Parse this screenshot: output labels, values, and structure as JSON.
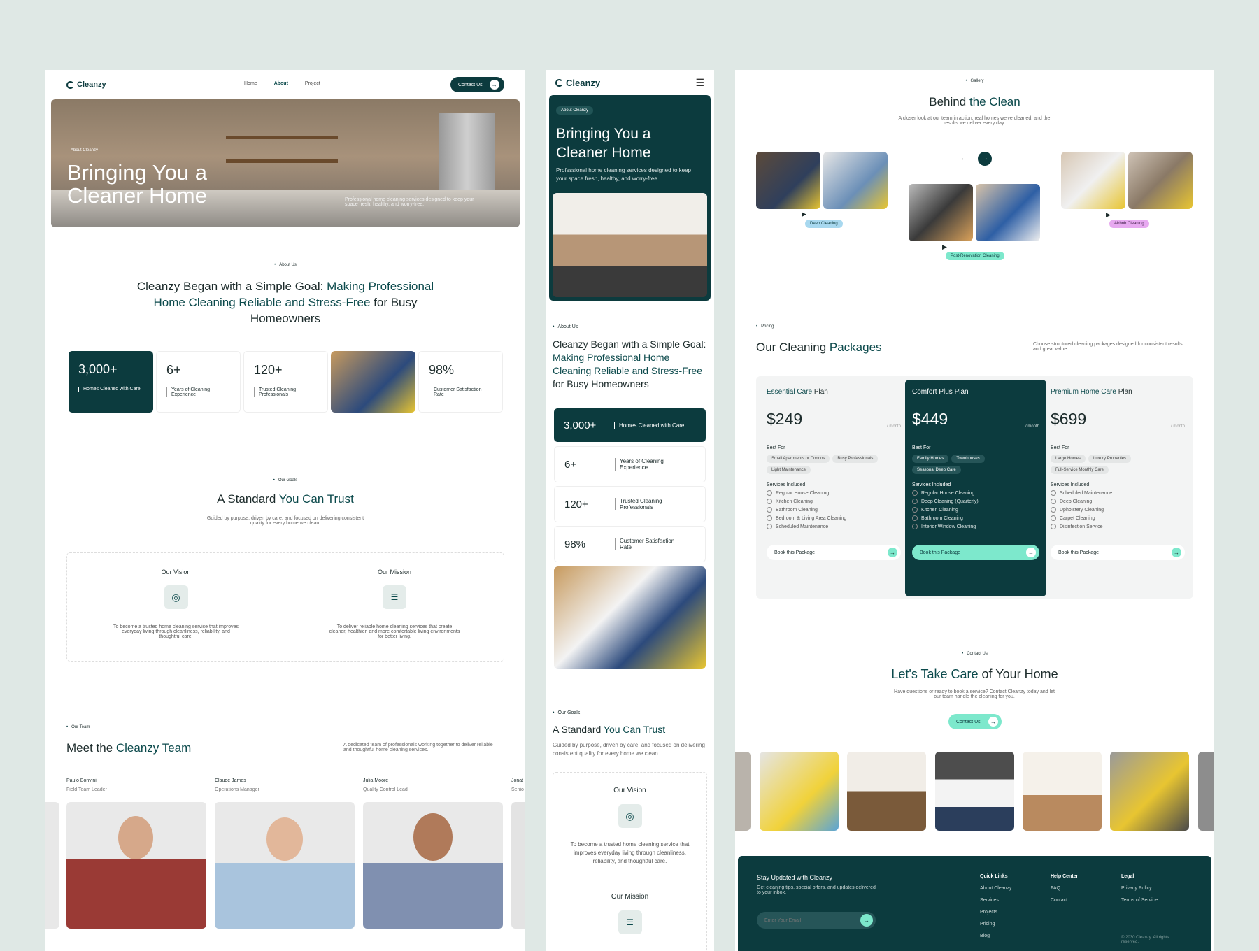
{
  "brand": "Cleanzy",
  "desktop": {
    "nav": {
      "home": "Home",
      "about": "About",
      "project": "Project",
      "contact": "Contact Us"
    },
    "hero": {
      "tag": "About Cleanzy",
      "title": "Bringing You a Cleaner Home",
      "desc": "Professional home cleaning services designed to keep your space fresh, healthy, and worry-free."
    },
    "about": {
      "tag": "About Us",
      "h_a": "Cleanzy Began with a Simple Goal: ",
      "h_b": "Making Professional Home Cleaning Reliable and Stress-Free",
      "h_c": " for Busy Homeowners"
    },
    "stats": [
      {
        "value": "3,000+",
        "label": "Homes Cleaned with Care"
      },
      {
        "value": "6+",
        "label": "Years of Cleaning Experience"
      },
      {
        "value": "120+",
        "label": "Trusted Cleaning Professionals"
      },
      {
        "value": "98%",
        "label": "Customer Satisfaction Rate"
      }
    ],
    "goals": {
      "tag": "Our Goals",
      "h_a": "A Standard ",
      "h_b": "You Can Trust",
      "desc": "Guided by purpose, driven by care, and focused on delivering consistent quality for every home we clean.",
      "vision_title": "Our Vision",
      "vision_text": "To become a trusted home cleaning service that improves everyday living through cleanliness, reliability, and thoughtful care.",
      "mission_title": "Our Mission",
      "mission_text": "To deliver reliable home cleaning services that create cleaner, healthier, and more comfortable living environments for better living."
    },
    "team": {
      "tag": "Our Team",
      "h_a": "Meet the ",
      "h_b": "Cleanzy Team",
      "desc": "A dedicated team of professionals working together to deliver reliable and thoughtful home cleaning services.",
      "members": [
        {
          "name": "Paulo Bonvini",
          "role": "Field Team Leader"
        },
        {
          "name": "Claude James",
          "role": "Operations Manager"
        },
        {
          "name": "Julia Moore",
          "role": "Quality Control Lead"
        },
        {
          "name": "Jonat",
          "role": "Senio"
        }
      ]
    }
  },
  "mobile": {
    "hero": {
      "tag": "About Cleanzy",
      "title": "Bringing You a Cleaner Home",
      "desc": "Professional home cleaning services designed to keep your space fresh, healthy, and worry-free."
    },
    "about": {
      "tag": "About Us",
      "h_a": "Cleanzy Began with a Simple Goal: ",
      "h_b": "Making Professional Home Cleaning Reliable and Stress-Free",
      "h_c": " for Busy Homeowners"
    },
    "stats": [
      {
        "value": "3,000+",
        "label": "Homes Cleaned with Care"
      },
      {
        "value": "6+",
        "label": "Years of Cleaning Experience"
      },
      {
        "value": "120+",
        "label": "Trusted Cleaning Professionals"
      },
      {
        "value": "98%",
        "label": "Customer Satisfaction Rate"
      }
    ],
    "goals": {
      "tag": "Our Goals",
      "h_a": "A Standard ",
      "h_b": "You Can Trust",
      "desc": "Guided by purpose, driven by care, and focused on delivering consistent quality for every home we clean.",
      "vision_title": "Our Vision",
      "vision_text": "To become a trusted home cleaning service that improves everyday living through cleanliness, reliability, and thoughtful care.",
      "mission_title": "Our Mission"
    }
  },
  "gallery": {
    "tag": "Gallery",
    "h_a": "Behind ",
    "h_b": "the Clean",
    "desc": "A closer look at our team in action, real homes we've cleaned, and the results we deliver every day.",
    "labels": [
      "Deep Cleaning",
      "Post-Renovation Cleaning",
      "Airbnb Cleaning"
    ]
  },
  "pricing": {
    "tag": "Pricing",
    "h_a": "Our Cleaning ",
    "h_b": "Packages",
    "desc": "Choose structured cleaning packages designed for consistent results and great value.",
    "per": "/ month",
    "best_for": "Best For",
    "included": "Services Included",
    "cta": "Book this Package",
    "plans": [
      {
        "name_a": "Essential Care ",
        "name_b": "Plan",
        "price": "$249",
        "tags": [
          "Small Apartments or Condos",
          "Busy Professionals",
          "Light Maintenance"
        ],
        "services": [
          "Regular House Cleaning",
          "Kitchen Cleaning",
          "Bathroom Cleaning",
          "Bedroom & Living Area Cleaning",
          "Scheduled Maintenance"
        ]
      },
      {
        "name_a": "Comfort Plus ",
        "name_b": "Plan",
        "price": "$449",
        "tags": [
          "Family Homes",
          "Townhouses",
          "Seasonal Deep Care"
        ],
        "services": [
          "Regular House Cleaning",
          "Deep Cleaning (Quarterly)",
          "Kitchen Cleaning",
          "Bathroom Cleaning",
          "Interior Window Cleaning"
        ]
      },
      {
        "name_a": "Premium Home Care ",
        "name_b": "Plan",
        "price": "$699",
        "tags": [
          "Large Homes",
          "Luxury Properties",
          "Full-Service Monthly Care"
        ],
        "services": [
          "Scheduled Maintenance",
          "Deep Cleaning",
          "Upholstery Cleaning",
          "Carpet Cleaning",
          "Disinfection Service"
        ]
      }
    ]
  },
  "contact": {
    "tag": "Contact Us",
    "h_a": "Let's Take Care ",
    "h_b": "of Your Home",
    "desc": "Have questions or ready to book a service? Contact Cleanzy today and let our team handle the cleaning for you.",
    "cta": "Contact Us"
  },
  "footer": {
    "title": "Stay Updated with Cleanzy",
    "desc": "Get cleaning tips, special offers, and updates delivered to your inbox.",
    "placeholder": "Enter Your Email",
    "quick": "Quick Links",
    "quick_items": [
      "About Cleanzy",
      "Services",
      "Projects",
      "Pricing",
      "Blog"
    ],
    "help": "Help Center",
    "help_items": [
      "FAQ",
      "Contact"
    ],
    "legal": "Legal",
    "legal_items": [
      "Privacy Policy",
      "Terms of Service"
    ],
    "copyright": "© 2030 Cleanzy. All rights reserved."
  }
}
